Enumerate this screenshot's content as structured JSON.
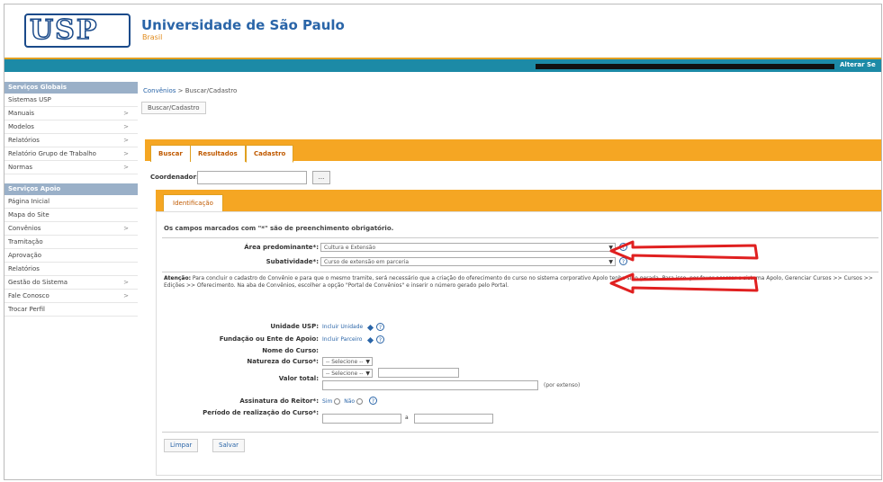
{
  "header": {
    "logo_text": "USP",
    "title": "Universidade de São Paulo",
    "subtitle": "Brasil",
    "alterar_label": "Alterar Se"
  },
  "sidebar": {
    "section1": "Serviços Globais",
    "items1": [
      {
        "label": "Sistemas USP",
        "arrow": ""
      },
      {
        "label": "Manuais",
        "arrow": ">"
      },
      {
        "label": "Modelos",
        "arrow": ">"
      },
      {
        "label": "Relatórios",
        "arrow": ">"
      },
      {
        "label": "Relatório Grupo de Trabalho",
        "arrow": ">"
      },
      {
        "label": "Normas",
        "arrow": ">"
      }
    ],
    "section2": "Serviços Apoio",
    "items2": [
      {
        "label": "Página Inicial",
        "arrow": ""
      },
      {
        "label": "Mapa do Site",
        "arrow": ""
      },
      {
        "label": "Convênios",
        "arrow": ">"
      },
      {
        "label": "Tramitação",
        "arrow": ""
      },
      {
        "label": "Aprovação",
        "arrow": ""
      },
      {
        "label": "Relatórios",
        "arrow": ""
      },
      {
        "label": "Gestão do Sistema",
        "arrow": ">"
      },
      {
        "label": "Fale Conosco",
        "arrow": ">"
      },
      {
        "label": "Trocar Perfil",
        "arrow": ""
      }
    ]
  },
  "breadcrumb": {
    "root": "Convênios",
    "separator": " > ",
    "current": "Buscar/Cadastro",
    "button": "Buscar/Cadastro"
  },
  "tabs": [
    {
      "label": "Buscar"
    },
    {
      "label": "Resultados"
    },
    {
      "label": "Cadastro"
    }
  ],
  "coordenador": {
    "label": "Coordenador:",
    "value": "",
    "button": "..."
  },
  "panel": {
    "tab": "Identificação",
    "required_note": "Os campos marcados com \"*\" são de preenchimento obrigatório.",
    "area_label": "Área predominante*:",
    "area_value": "Cultura e Extensão",
    "subatividade_label": "Subatividade*:",
    "subatividade_value": "Curso de extensão em parceria",
    "attention_title": "Atenção:",
    "attention_text": "Para concluir o cadastro do Convênio e para que o mesmo tramite, será necessário que a criação do oferecimento do curso no sistema corporativo Apolo tenha sido gerada. Para isso, por favor acessar o sistema Apolo, Gerenciar Cursos >> Cursos >> Edições >> Oferecimento. Na aba de Convênios, escolher a opção \"Portal de Convênios\" e inserir o número gerado pelo Portal.",
    "unidade_label": "Unidade USP:",
    "unidade_link": "Incluir Unidade",
    "fundacao_label": "Fundação ou Ente de Apoio:",
    "fundacao_link": "Incluir Parceiro",
    "nome_curso_label": "Nome do Curso:",
    "natureza_label": "Natureza do Curso*:",
    "natureza_value": "-- Selecione --",
    "valor_label": "Valor total:",
    "valor_select": "-- Selecione --",
    "valor_extenso": "(por extenso)",
    "assinatura_label": "Assinatura do Reitor*:",
    "sim": "Sim",
    "nao": "Não",
    "periodo_label": "Período de realização do Curso*:",
    "periodo_sep": "a",
    "limpar": "Limpar",
    "salvar": "Salvar"
  },
  "colors": {
    "accent_orange": "#f5a623",
    "brand_blue": "#2a65a8",
    "topbar_teal": "#1c8aa6",
    "arrow_red": "#e02020"
  }
}
